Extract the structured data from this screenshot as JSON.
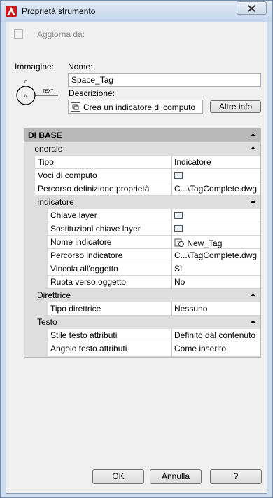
{
  "window": {
    "title": "Proprietà strumento"
  },
  "update": {
    "label": "Aggiorna da:",
    "checked": false
  },
  "image": {
    "label": "Immagine:",
    "preview_text": "TEXT",
    "preview_tag": "D"
  },
  "name": {
    "label": "Nome:",
    "value": "Space_Tag"
  },
  "description": {
    "label": "Descrizione:",
    "value": "Crea un indicatore di computo"
  },
  "more_button": "Altre info",
  "grid": {
    "section": "DI BASE",
    "generale": {
      "label": "Generale",
      "rows": [
        {
          "name": "Tipo",
          "value": "Indicatore"
        },
        {
          "name": "Voci di computo",
          "value": "",
          "icon": "list-icon"
        },
        {
          "name": "Percorso definizione proprietà",
          "value": "C...\\TagComplete.dwg"
        }
      ],
      "indicatore": {
        "label": "Indicatore",
        "rows": [
          {
            "name": "Chiave layer",
            "value": "",
            "icon": "list-icon"
          },
          {
            "name": "Sostituzioni chiave layer",
            "value": "",
            "icon": "list-icon"
          },
          {
            "name": "Nome indicatore",
            "value": "New_Tag",
            "icon": "tag-icon"
          },
          {
            "name": "Percorso indicatore",
            "value": "C...\\TagComplete.dwg"
          },
          {
            "name": "Vincola all'oggetto",
            "value": "Sì"
          },
          {
            "name": "Ruota verso oggetto",
            "value": "No"
          }
        ]
      },
      "direttrice": {
        "label": "Direttrice",
        "rows": [
          {
            "name": "Tipo direttrice",
            "value": "Nessuno"
          }
        ]
      },
      "testo": {
        "label": "Testo",
        "rows": [
          {
            "name": "Stile testo attributi",
            "value": "Definito dal contenuto"
          },
          {
            "name": "Angolo testo attributi",
            "value": "Come inserito"
          }
        ]
      }
    }
  },
  "buttons": {
    "ok": "OK",
    "cancel": "Annulla",
    "help": "?"
  }
}
